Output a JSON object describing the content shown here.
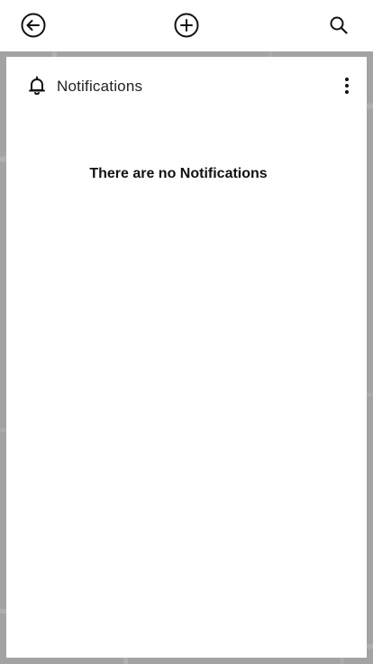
{
  "topbar": {
    "back_icon": "arrow-left-circle",
    "add_icon": "plus-circle",
    "search_icon": "magnifier"
  },
  "notifications_panel": {
    "title": "Notifications",
    "icon": "bell",
    "menu_icon": "vertical-ellipsis",
    "empty_message": "There are no Notifications"
  },
  "colors": {
    "bar_bg": "#ffffff",
    "overlay": "#a3a3a3",
    "text": "#111111"
  }
}
